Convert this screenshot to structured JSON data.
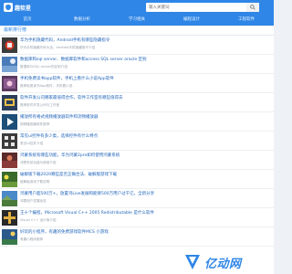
{
  "header": {
    "logo_text": "趣软星",
    "search_placeholder": "输入关键词",
    "nav": [
      "首页",
      "数据分析",
      "学习相关",
      "编程设计",
      "工程软件"
    ]
  },
  "main": {
    "section_title": "最新排行榜",
    "items": [
      {
        "title": "华为手机隐藏代码，Android手机有哪些隐藏指令",
        "desc": "华为手机隐藏代码大全，Android手机隐藏指令介绍"
      },
      {
        "title": "数据库和sql server、数据库软件和access SQL server oracle 区别",
        "desc": "数据库与SQL server的区别介绍"
      },
      {
        "title": "手机免费读书app软件，手机上看什么小说App软件",
        "desc": "推荐免费读书App软件，手机看小说"
      },
      {
        "title": "软件开发公司哪家最值得合作，软件工作室有哪些值得去",
        "desc": "推荐软件开发公司与工作室"
      },
      {
        "title": "播放所有格式视频播放器软件和流畅播放器",
        "desc": "视频播放器软件推荐"
      },
      {
        "title": "常见ui控件有多少类，选择控件有什么特点",
        "desc": "常见UI控件介绍"
      },
      {
        "title": "鸿蒙系统有哪些功能，华为鸿蒙2pro如何使用鸿蒙系统",
        "desc": "鸿蒙系统功能与使用介绍"
      },
      {
        "title": "破解版下载2020哪些是否正确合法、破解版游戏下载",
        "desc": "破解版游戏下载说明"
      },
      {
        "title": "鸿蒙用户超500万+，放置鸿Live发展和能够500万用户过千亿，全新分享",
        "desc": "鸿蒙用户发展动态"
      },
      {
        "title": "王十个编程，Microsoft Visual C++ 2005 Redistributable 是什么软件",
        "desc": "Visual C++ 运行库介绍"
      },
      {
        "title": "好玩的小程序，有趣的免费游戏软件MCS 小游戏",
        "desc": "有趣小程序推荐"
      }
    ]
  },
  "watermark": {
    "text": "亿动网"
  },
  "colors": {
    "accent": "#2f86e6",
    "link": "#2266bb",
    "muted": "#9aa3ad"
  },
  "icons": [
    "shield-logo-icon",
    "search-icon"
  ]
}
